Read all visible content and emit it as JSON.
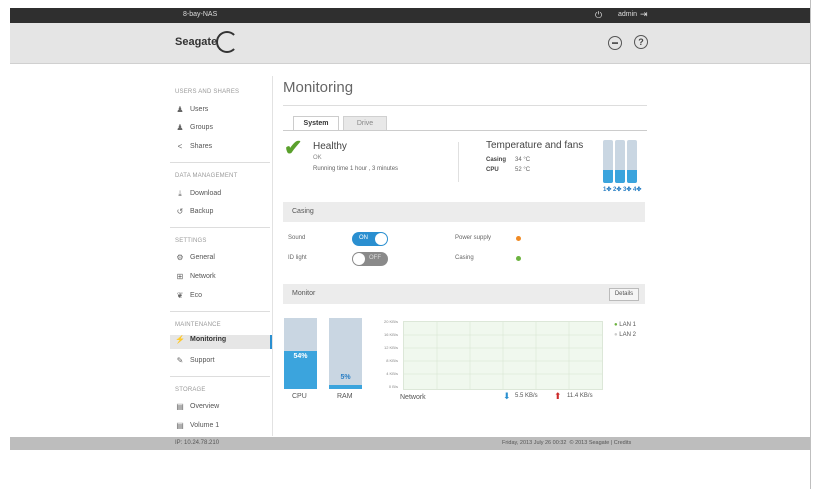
{
  "topbar": {
    "device_name": "8-bay-NAS",
    "user": "admin"
  },
  "header": {
    "brand": "Seagate"
  },
  "sidebar": {
    "sections": [
      {
        "title": "USERS AND SHARES",
        "items": [
          {
            "label": "Users",
            "icon": "user-icon"
          },
          {
            "label": "Groups",
            "icon": "groups-icon"
          },
          {
            "label": "Shares",
            "icon": "share-icon"
          }
        ]
      },
      {
        "title": "DATA MANAGEMENT",
        "items": [
          {
            "label": "Download",
            "icon": "download-icon"
          },
          {
            "label": "Backup",
            "icon": "backup-icon"
          }
        ]
      },
      {
        "title": "SETTINGS",
        "items": [
          {
            "label": "General",
            "icon": "gear-icon"
          },
          {
            "label": "Network",
            "icon": "network-icon"
          },
          {
            "label": "Eco",
            "icon": "eco-icon"
          }
        ]
      },
      {
        "title": "MAINTENANCE",
        "items": [
          {
            "label": "Monitoring",
            "icon": "monitoring-icon"
          },
          {
            "label": "Support",
            "icon": "wrench-icon"
          }
        ]
      },
      {
        "title": "STORAGE",
        "items": [
          {
            "label": "Overview",
            "icon": "storage-icon"
          },
          {
            "label": "Volume 1",
            "icon": "volume-icon"
          }
        ]
      }
    ],
    "active_item": "Monitoring"
  },
  "main": {
    "title": "Monitoring",
    "tabs": [
      {
        "label": "System"
      },
      {
        "label": "Drive"
      }
    ],
    "health": {
      "status": "Healthy",
      "sub": "OK",
      "running_time": "Running time  1 hour , 3 minutes"
    },
    "temperature": {
      "title": "Temperature and fans",
      "casing_label": "Casing",
      "casing_value": "34 °C",
      "cpu_label": "CPU",
      "cpu_value": "52 °C"
    },
    "fans": [
      {
        "label": "1",
        "level": 0.3
      },
      {
        "label": "2",
        "level": 0.3
      },
      {
        "label": "3",
        "level": 0.3
      },
      {
        "label": "4",
        "level": 0.3
      }
    ],
    "casing": {
      "title": "Casing",
      "sound_label": "Sound",
      "sound_state": "ON",
      "idlight_label": "ID light",
      "idlight_state": "OFF",
      "power_label": "Power supply",
      "power_color": "#f08a24",
      "casing_label": "Casing",
      "casing_color": "#6cb33f"
    },
    "monitor": {
      "title": "Monitor",
      "details_label": "Details",
      "cpu": {
        "label": "CPU",
        "value_text": "54%",
        "value": 54
      },
      "ram": {
        "label": "RAM",
        "value_text": "5%",
        "value": 5
      },
      "network": {
        "label": "Network",
        "y_ticks": [
          "20 KB/s",
          "16 KB/s",
          "12 KB/s",
          "8 KB/s",
          "4 KB/s",
          "0 B/s"
        ],
        "legend": [
          {
            "name": "LAN 1",
            "color": "#6cb33f"
          },
          {
            "name": "LAN 2",
            "color": "#cccccc"
          }
        ],
        "down": "5.5 KB/s",
        "up": "11.4 KB/s"
      }
    }
  },
  "footer": {
    "ip": "IP: 10.24.78.210",
    "datetime": "Friday, 2013 July 26   00:32",
    "copyright": "© 2013 Seagate | Credits"
  },
  "colors": {
    "accent": "#2a8fd0",
    "bar_fill": "#3ba4dd",
    "bar_bg": "#c9d6e2",
    "ok_green": "#5aa02c",
    "up_red": "#cc2a2a"
  }
}
